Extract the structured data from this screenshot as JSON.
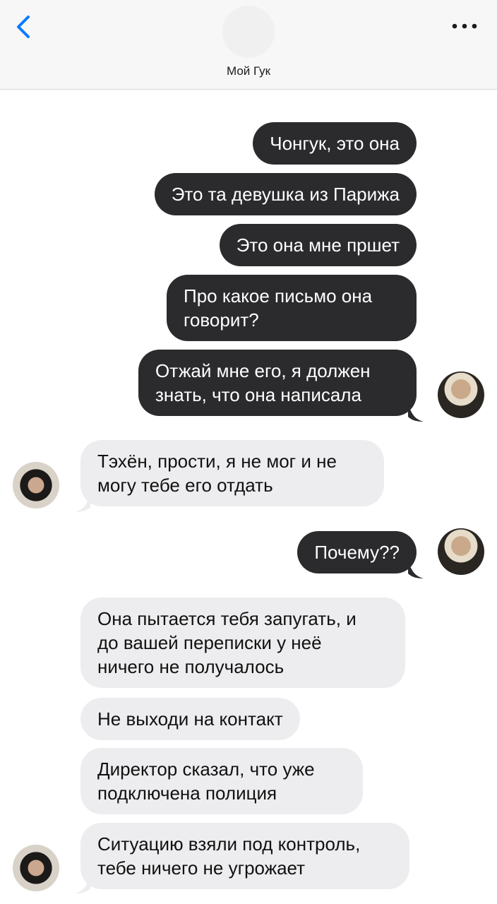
{
  "header": {
    "contact_name": "Мой Гук",
    "back_icon": "chevron-left-icon",
    "menu_icon": "more-horizontal-icon",
    "accent_color": "#0a7cff"
  },
  "messages": [
    {
      "side": "out",
      "text": "Чонгук, это она"
    },
    {
      "side": "out",
      "text": "Это та девушка из Парижа"
    },
    {
      "side": "out",
      "text": "Это она мне пршет"
    },
    {
      "side": "out",
      "text": "Про какое письмо она\nговорит?"
    },
    {
      "side": "out",
      "text": "Отжай мне его, я должен\nзнать, что она написала"
    },
    {
      "side": "in",
      "text": "Тэхён, прости, я не мог и не\nмогу тебе его отдать"
    },
    {
      "side": "out",
      "text": "Почему??"
    },
    {
      "side": "in",
      "text": "Она пытается тебя запугать, и\nдо вашей переписки у неё\nничего не получалось"
    },
    {
      "side": "in",
      "text": "Не выходи на контакт"
    },
    {
      "side": "in",
      "text": "Директор сказал, что уже\nподключена полиция"
    },
    {
      "side": "in",
      "text": "Ситуацию взяли под контроль,\nтебе ничего не угрожает"
    }
  ],
  "colors": {
    "outgoing_bubble": "#2b2b2e",
    "incoming_bubble": "#ededef"
  }
}
